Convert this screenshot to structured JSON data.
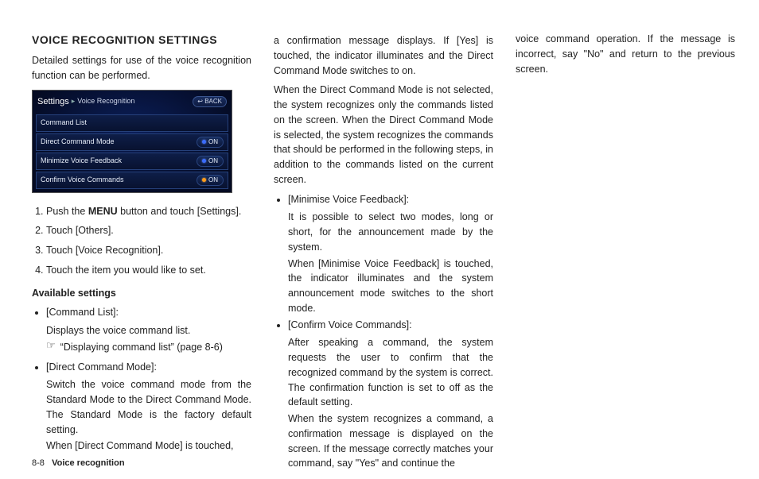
{
  "footer": {
    "page": "8-8",
    "section": "Voice recognition"
  },
  "col1": {
    "title": "VOICE RECOGNITION SETTINGS",
    "intro": "Detailed settings for use of the voice recognition function can be performed.",
    "shot": {
      "settings": "Settings",
      "sub": "Voice Recognition",
      "back": "↩ BACK",
      "rows": [
        {
          "label": "Command List",
          "pill": null
        },
        {
          "label": "Direct Command Mode",
          "pill": "ON",
          "dot": "blue"
        },
        {
          "label": "Minimize Voice Feedback",
          "pill": "ON",
          "dot": "blue"
        },
        {
          "label": "Confirm Voice Commands",
          "pill": "ON",
          "dot": "amber"
        }
      ]
    },
    "steps": {
      "s1a": "Push the ",
      "s1b": "MENU",
      "s1c": " button and touch [Settings].",
      "s2": "Touch [Others].",
      "s3": "Touch [Voice Recognition].",
      "s4": "Touch the item you would like to set."
    },
    "available": "Available settings",
    "cmdListHead": "[Command List]:",
    "cmdListBody": "Displays the voice command list.",
    "refText": "“Displaying command list” (page 8-6)",
    "dcmHead": "[Direct Command Mode]:",
    "dcmBody": "Switch the voice command mode from the Standard Mode to the Direct Command Mode. The Standard Mode is the factory default setting.",
    "dcmBody2": "When [Direct Command Mode] is touched,"
  },
  "col2": {
    "p1": "a confirmation message displays. If [Yes] is touched, the indicator illuminates and the Direct Command Mode switches to on.",
    "p2": "When the Direct Command Mode is not selected, the system recognizes only the commands listed on the screen. When the Direct Command Mode is selected, the system recognizes the commands that should be performed in the following steps, in addition to the commands listed on the current screen.",
    "mvfHead": "[Minimise Voice Feedback]:",
    "mvf1": "It is possible to select two modes, long or short, for the announcement made by the system.",
    "mvf2": "When [Minimise Voice Feedback] is touched, the indicator illuminates and the system announcement mode switches to the short mode.",
    "cvcHead": "[Confirm Voice Commands]:",
    "cvc1": "After speaking a command, the system requests the user to confirm that the recognized command by the system is correct. The confirmation function is set to off as the default setting.",
    "cvc2": "When the system recognizes a command, a confirmation message is displayed on the screen. If the message correctly matches your command, say \"Yes\" and continue the"
  },
  "col3": {
    "p1": "voice command operation. If the message is incorrect, say \"No\" and return to the previous screen."
  }
}
